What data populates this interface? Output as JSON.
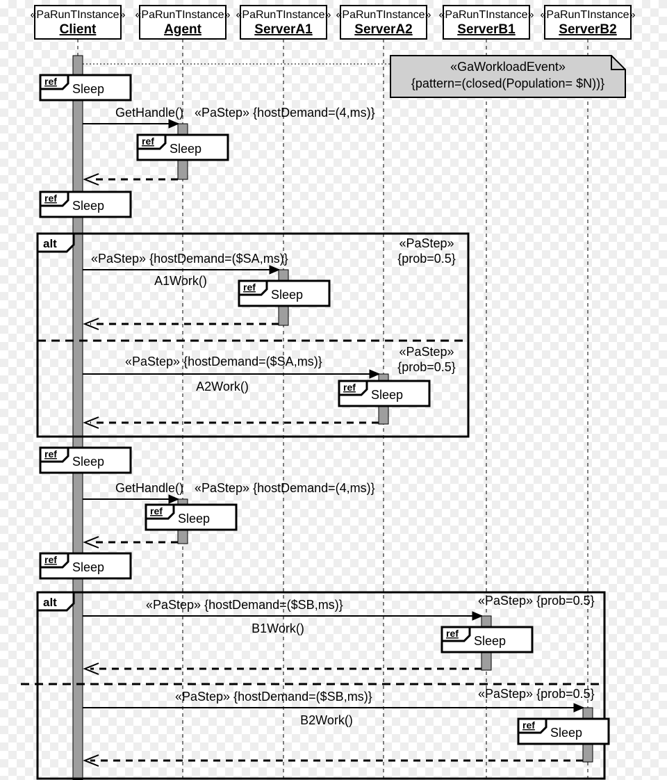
{
  "stereotype_lifeline": "«PaRunTInstance»",
  "lifelines": {
    "client": "Client",
    "agent": "Agent",
    "serverA1": "ServerA1",
    "serverA2": "ServerA2",
    "serverB1": "ServerB1",
    "serverB2": "ServerB2"
  },
  "note": {
    "stereo": "«GaWorkloadEvent»",
    "body": "{pattern=(closed(Population= $N))}"
  },
  "ref_label": "ref",
  "sleep": "Sleep",
  "alt_label": "alt",
  "messages": {
    "getHandle": "GetHandle()",
    "a1work": "A1Work()",
    "a2work": "A2Work()",
    "b1work": "B1Work()",
    "b2work": "B2Work()"
  },
  "pastep": {
    "stereo": "«PaStep»",
    "hd4": "{hostDemand=(4,ms)}",
    "hdSA": "{hostDemand=($SA,ms)}",
    "hdSB": "{hostDemand=($SB,ms)}",
    "prob": "{prob=0.5}"
  }
}
